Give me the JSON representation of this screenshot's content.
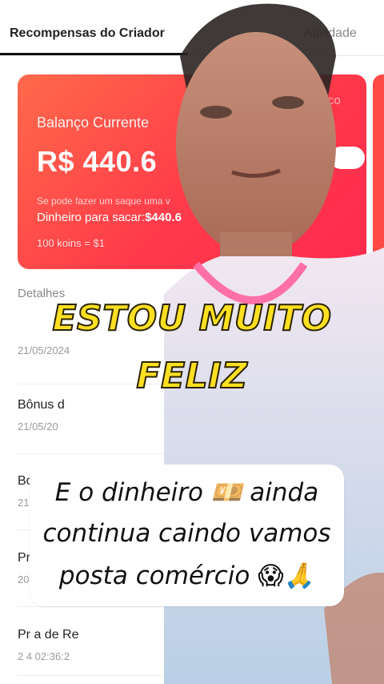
{
  "tabs": {
    "active": "Recompensas do Criador",
    "inactive": "Atividade"
  },
  "balance_card": {
    "label": "Balanço Currente",
    "amount": "R$ 440.6",
    "note": "Se pode fazer um saque uma v",
    "withdraw_label": "Dinheiro para sacar:",
    "withdraw_value": "$440.6",
    "rate": "100 koins = $1",
    "corner_text": "co"
  },
  "details": {
    "title": "Detalhes",
    "rows": [
      {
        "title": "",
        "sub": "21/05/2024"
      },
      {
        "title": "Bônus d",
        "sub": "21/05/20"
      },
      {
        "title": "Bo",
        "sub": "21"
      },
      {
        "title": "Pr",
        "sub": "20"
      },
      {
        "title": "Pr     a de Re",
        "sub": "2         4 02:36:2"
      }
    ]
  },
  "captions": {
    "headline_1": "ESTOU MUITO",
    "headline_2": "FELIZ",
    "bubble_line_1": "E o dinheiro 💴 ainda",
    "bubble_line_2": "continua caindo vamos",
    "bubble_line_3": "posta comércio 😱🙏"
  },
  "colors": {
    "card_start": "#ff6a4a",
    "card_end": "#ff2a4f",
    "headline_fill": "#ffe021"
  }
}
